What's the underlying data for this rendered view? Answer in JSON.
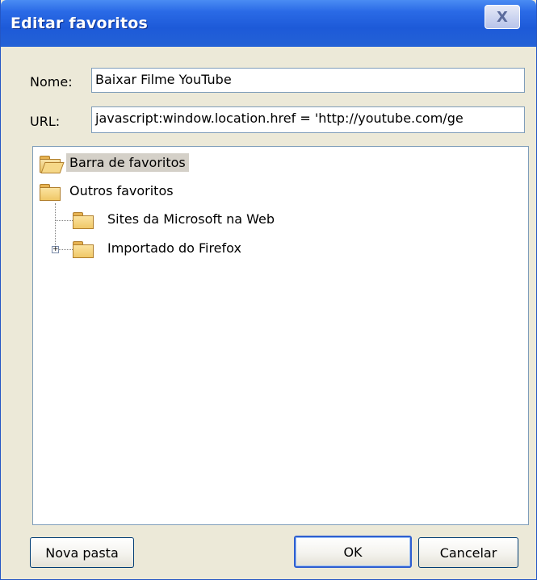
{
  "window": {
    "title": "Editar favoritos",
    "close_label": "X"
  },
  "form": {
    "name_label": "Nome:",
    "name_value": "Baixar Filme YouTube",
    "url_label": "URL:",
    "url_value": "javascript:window.location.href = 'http://youtube.com/ge"
  },
  "tree": {
    "items": [
      {
        "label": "Barra de favoritos",
        "selected": true,
        "icon": "open-folder-icon"
      },
      {
        "label": "Outros favoritos",
        "icon": "folder-icon"
      },
      {
        "label": "Sites da Microsoft na Web",
        "icon": "folder-icon"
      },
      {
        "label": "Importado do Firefox",
        "icon": "folder-icon",
        "expander": "+"
      }
    ]
  },
  "buttons": {
    "new_folder": "Nova pasta",
    "ok": "OK",
    "cancel": "Cancelar"
  },
  "colors": {
    "titlebar": "#2a6ae6",
    "dialog": "#ece9d8",
    "selection": "#d4d0c8"
  }
}
